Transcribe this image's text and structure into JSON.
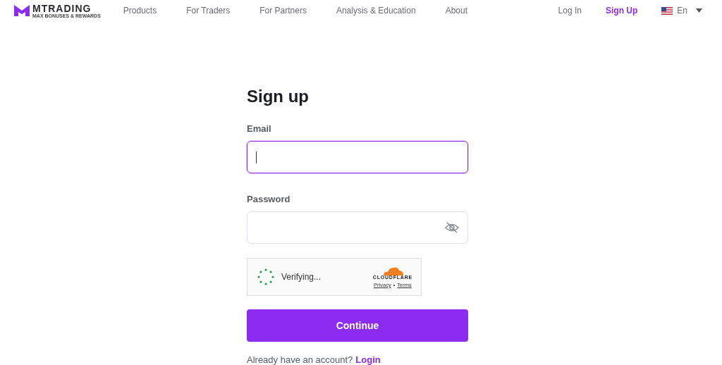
{
  "header": {
    "logo": {
      "name": "MTRADING",
      "tagline": "MAX BONUSES & REWARDS"
    },
    "nav": [
      {
        "label": "Products"
      },
      {
        "label": "For Traders"
      },
      {
        "label": "For Partners"
      },
      {
        "label": "Analysis & Education"
      },
      {
        "label": "About"
      }
    ],
    "auth": [
      {
        "label": "Log In",
        "highlighted": false
      },
      {
        "label": "Sign Up",
        "highlighted": true
      }
    ],
    "language": {
      "label": "En"
    }
  },
  "form": {
    "title": "Sign up",
    "fields": [
      {
        "label": "Email",
        "kind": "text",
        "focused": true
      },
      {
        "label": "Password",
        "kind": "password",
        "focused": false
      }
    ],
    "captcha": {
      "status": "Verifying...",
      "brand": "CLOUDFLARE",
      "links": [
        "Privacy",
        "Terms"
      ],
      "separator": "•"
    },
    "submit": "Continue",
    "footer": {
      "text": "Already have an account?",
      "link": "Login"
    }
  }
}
